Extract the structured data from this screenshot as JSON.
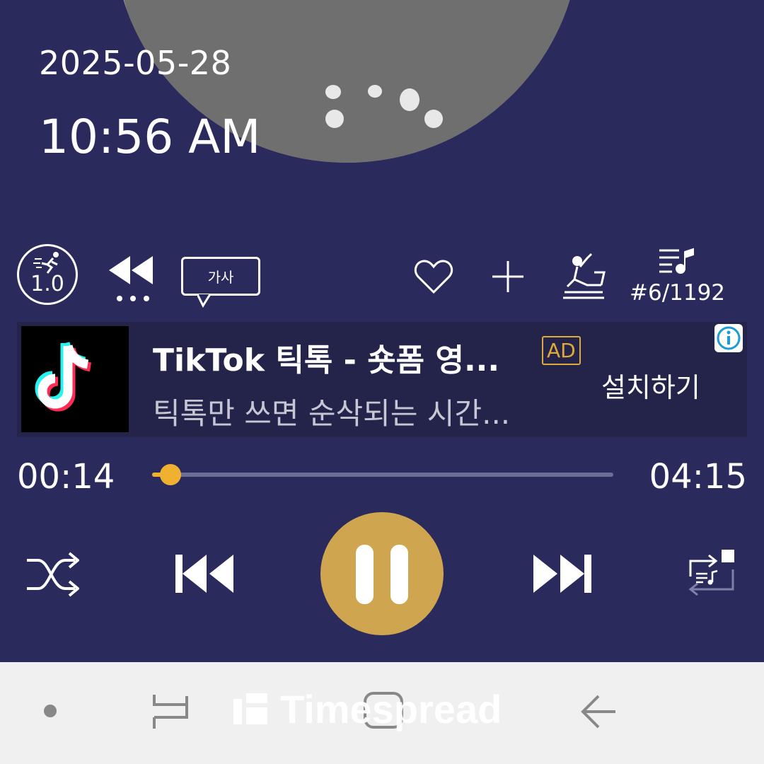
{
  "status": {
    "date": "2025-05-28",
    "time": "10:56 AM"
  },
  "toolbar": {
    "speed_label": "1.0",
    "lyrics_label": "가사",
    "queue_position": "#6/1192"
  },
  "ad": {
    "title": "TikTok 틱톡 - 숏폼 영...",
    "badge": "AD",
    "subtitle": "틱톡만 쓰면 순삭되는 시간...",
    "install_label": "설치하기"
  },
  "player": {
    "elapsed": "00:14",
    "total": "04:15",
    "progress_fraction": 0.04
  },
  "watermark": "Timespread",
  "colors": {
    "background": "#2b2a5c",
    "accent": "#f0b030",
    "play_button": "#cfa54f",
    "nav_bar": "#f0f0f0"
  }
}
